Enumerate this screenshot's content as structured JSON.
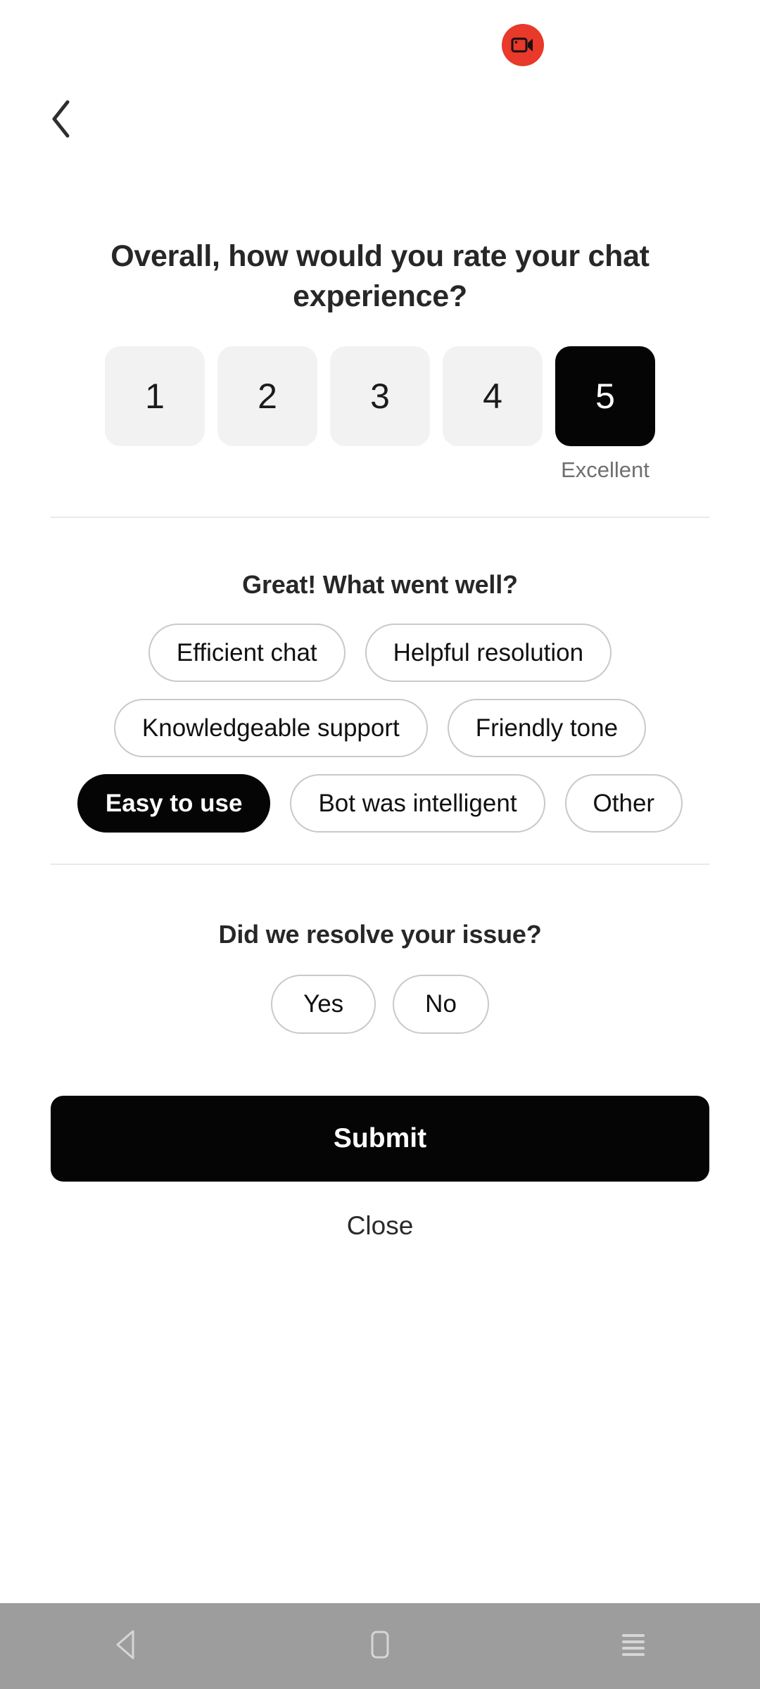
{
  "status_bar": {
    "recording_badge_icon": "video-camera-icon",
    "recording_badge_color": "#e8392b"
  },
  "header": {
    "back_icon": "chevron-left-icon"
  },
  "survey": {
    "rating_question": {
      "title": "Overall, how would you rate your chat experience?",
      "options": [
        {
          "value": "1",
          "selected": false,
          "caption": ""
        },
        {
          "value": "2",
          "selected": false,
          "caption": ""
        },
        {
          "value": "3",
          "selected": false,
          "caption": ""
        },
        {
          "value": "4",
          "selected": false,
          "caption": ""
        },
        {
          "value": "5",
          "selected": true,
          "caption": "Excellent"
        }
      ],
      "selected_value": "5",
      "selected_caption": "Excellent"
    },
    "positive_question": {
      "title": "Great! What went well?",
      "chips": [
        {
          "label": "Efficient chat",
          "selected": false
        },
        {
          "label": "Helpful resolution",
          "selected": false
        },
        {
          "label": "Knowledgeable support",
          "selected": false
        },
        {
          "label": "Friendly tone",
          "selected": false
        },
        {
          "label": "Easy to use",
          "selected": true
        },
        {
          "label": "Bot was intelligent",
          "selected": false
        },
        {
          "label": "Other",
          "selected": false
        }
      ]
    },
    "resolve_question": {
      "title": "Did we resolve your issue?",
      "chips": [
        {
          "label": "Yes",
          "selected": false
        },
        {
          "label": "No",
          "selected": false
        }
      ]
    }
  },
  "actions": {
    "submit_label": "Submit",
    "close_label": "Close"
  },
  "navbar": {
    "back_icon": "triangle-back-icon",
    "home_icon": "square-home-icon",
    "recents_icon": "hamburger-recents-icon"
  },
  "colors": {
    "accent": "#050505",
    "recording": "#e8392b",
    "chip_border": "#c9c9c9",
    "rating_idle": "#f2f2f2",
    "navbar": "#9d9d9d"
  }
}
